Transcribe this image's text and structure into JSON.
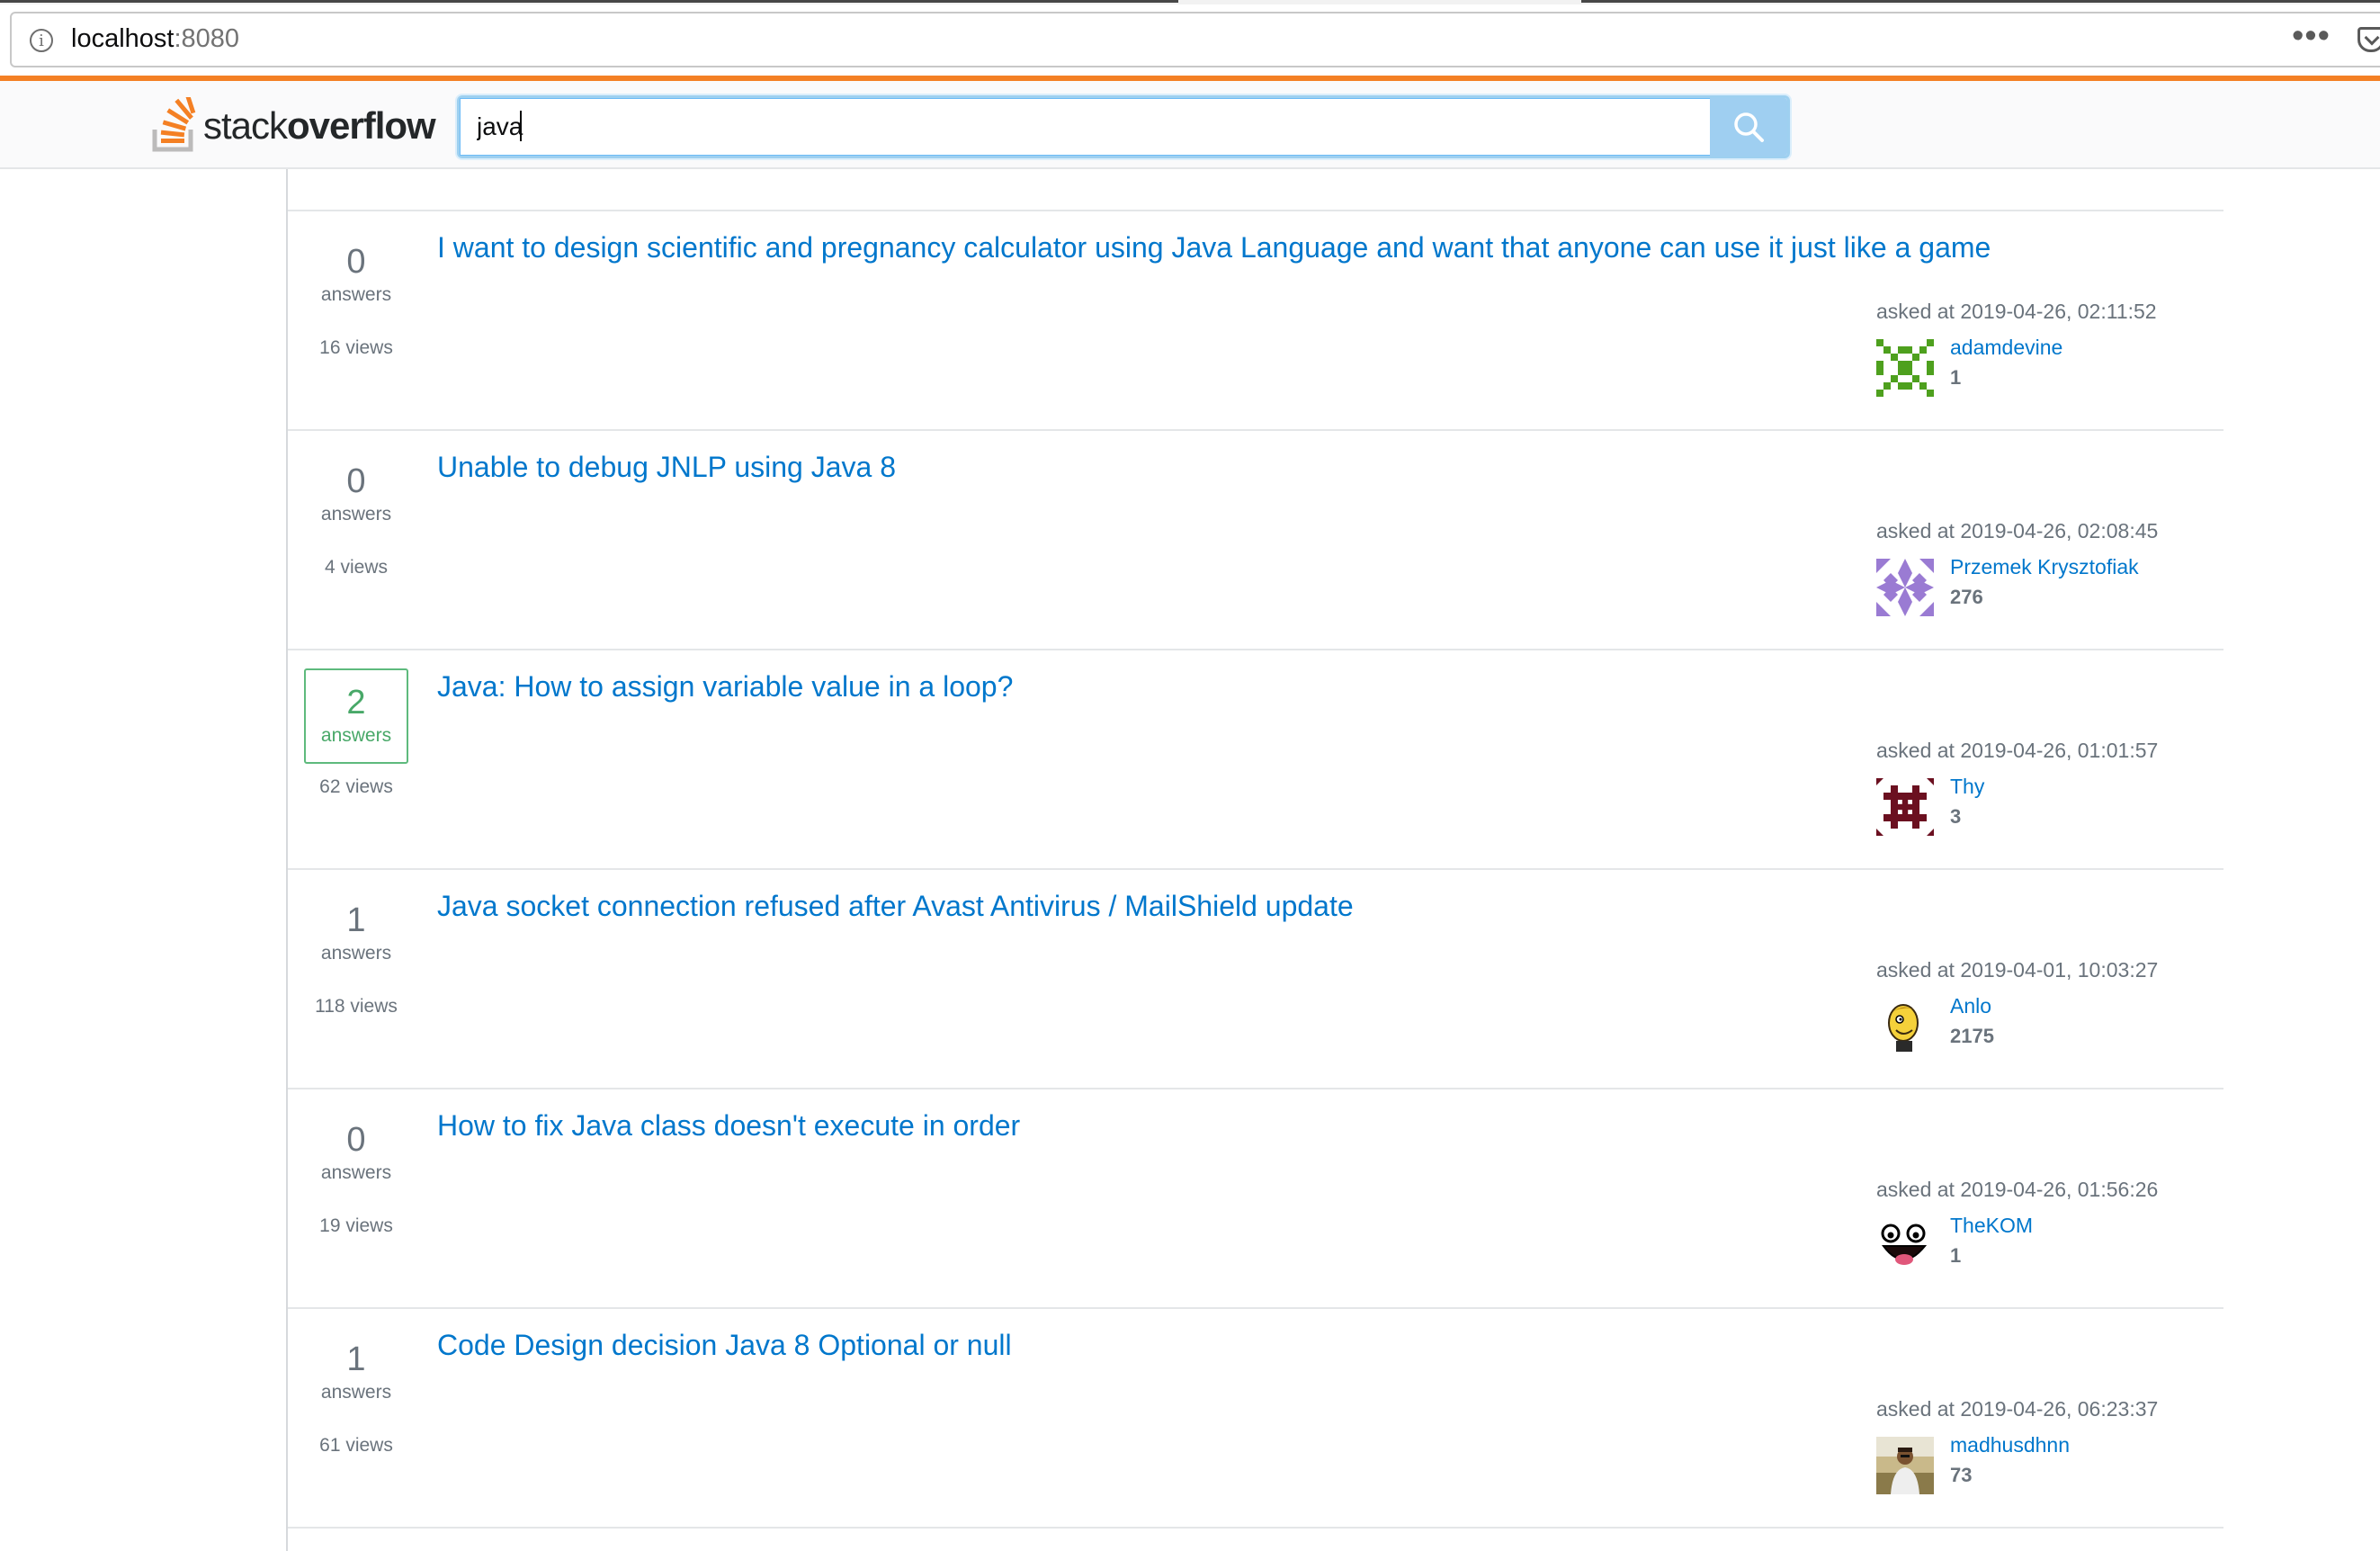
{
  "browser": {
    "url_host": "localhost",
    "url_port": ":8080"
  },
  "header": {
    "logo_light": "stack",
    "logo_bold": "overflow",
    "search_value": "java"
  },
  "colors": {
    "accent": "#f48024",
    "link": "#0077cc",
    "answered": "#5eba7d"
  },
  "questions": [
    {
      "answers": "0",
      "answers_label": "answers",
      "views": "16 views",
      "answered": false,
      "title": "I want to design scientific and pregnancy calculator using Java Language and want that anyone can use it just like a game",
      "asked": "asked at 2019-04-26, 02:11:52",
      "user": "adamdevine",
      "rep": "1",
      "avatar": "green-identicon"
    },
    {
      "answers": "0",
      "answers_label": "answers",
      "views": "4 views",
      "answered": false,
      "title": "Unable to debug JNLP using Java 8",
      "asked": "asked at 2019-04-26, 02:08:45",
      "user": "Przemek Krysztofiak",
      "rep": "276",
      "avatar": "purple-identicon"
    },
    {
      "answers": "2",
      "answers_label": "answers",
      "views": "62 views",
      "answered": true,
      "title": "Java: How to assign variable value in a loop?",
      "asked": "asked at 2019-04-26, 01:01:57",
      "user": "Thy",
      "rep": "3",
      "avatar": "maroon-identicon"
    },
    {
      "answers": "1",
      "answers_label": "answers",
      "views": "118 views",
      "answered": false,
      "title": "Java socket connection refused after Avast Antivirus / MailShield update",
      "asked": "asked at 2019-04-01, 10:03:27",
      "user": "Anlo",
      "rep": "2175",
      "avatar": "cartoon-face-avatar"
    },
    {
      "answers": "0",
      "answers_label": "answers",
      "views": "19 views",
      "answered": false,
      "title": "How to fix Java class doesn't execute in order",
      "asked": "asked at 2019-04-26, 01:56:26",
      "user": "TheKOM",
      "rep": "1",
      "avatar": "smiley-face-avatar"
    },
    {
      "answers": "1",
      "answers_label": "answers",
      "views": "61 views",
      "answered": false,
      "title": "Code Design decision Java 8 Optional or null",
      "asked": "asked at 2019-04-26, 06:23:37",
      "user": "madhusdhnn",
      "rep": "73",
      "avatar": "photo-avatar"
    }
  ]
}
